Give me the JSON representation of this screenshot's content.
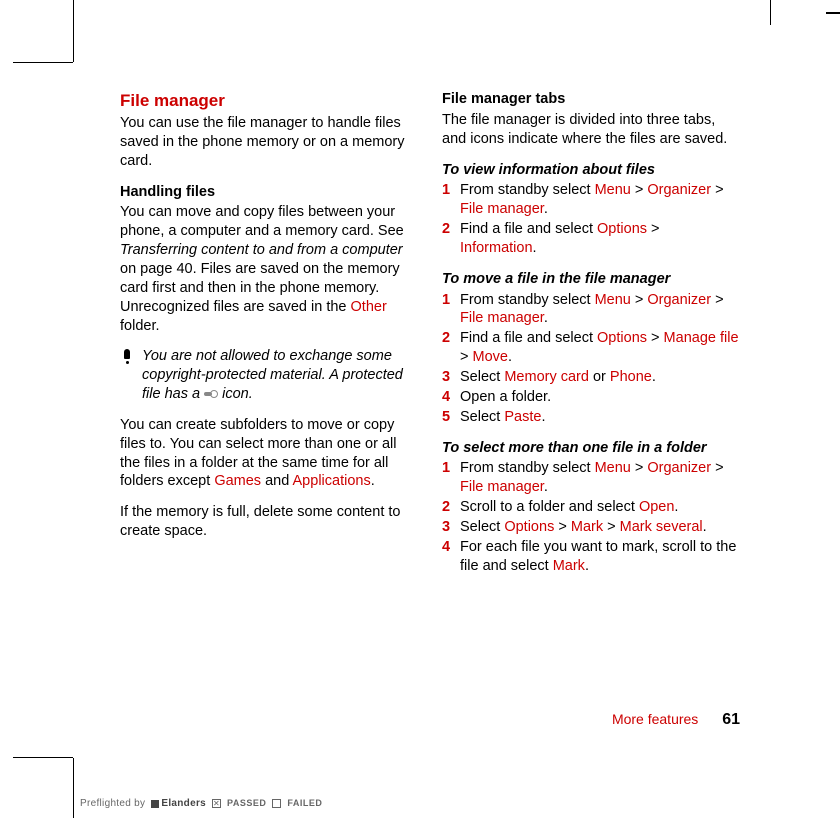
{
  "left": {
    "heading": "File manager",
    "intro": "You can use the file manager to handle files saved in the phone memory or on a memory card.",
    "handling_heading": "Handling files",
    "handling_body_a": "You can move and copy files between your phone, a computer and a memory card. See ",
    "handling_body_ref": "Transferring content to and from a computer",
    "handling_body_b": " on page 40. Files are saved on the memory card first and then in the phone memory. Unrecognized files are saved in the ",
    "handling_body_link": "Other",
    "handling_body_c": " folder.",
    "note_a": "You are not allowed to exchange some copyright-protected material. A protected file has a ",
    "note_b": " icon.",
    "subfolders_a": "You can create subfolders to move or copy files to. You can select more than one or all the files in a folder at the same time for all folders except ",
    "subfolders_link1": "Games",
    "subfolders_mid": " and ",
    "subfolders_link2": "Applications",
    "subfolders_c": ".",
    "memory_full": "If the memory is full, delete some content to create space."
  },
  "right": {
    "tabs_heading": "File manager tabs",
    "tabs_body": "The file manager is divided into three tabs, and icons indicate where the files are saved.",
    "view_heading": "To view information about files",
    "view_steps": [
      {
        "pre": "From standby select ",
        "l1": "Menu",
        "m1": " > ",
        "l2": "Organizer",
        "m2": " > ",
        "l3": "File manager",
        "post": "."
      },
      {
        "pre": "Find a file and select ",
        "l1": "Options",
        "m1": " > ",
        "l2": "Information",
        "post": "."
      }
    ],
    "move_heading": "To move a file in the file manager",
    "move_steps": [
      {
        "pre": "From standby select ",
        "l1": "Menu",
        "m1": " > ",
        "l2": "Organizer",
        "m2": " > ",
        "l3": "File manager",
        "post": "."
      },
      {
        "pre": "Find a file and select ",
        "l1": "Options",
        "m1": " > ",
        "l2": "Manage file",
        "m2": " > ",
        "l3": "Move",
        "post": "."
      },
      {
        "pre": "Select ",
        "l1": "Memory card",
        "m1": " or ",
        "l2": "Phone",
        "post": "."
      },
      {
        "pre": "Open a folder."
      },
      {
        "pre": "Select ",
        "l1": "Paste",
        "post": "."
      }
    ],
    "select_heading": "To select more than one file in a folder",
    "select_steps": [
      {
        "pre": "From standby select ",
        "l1": "Menu",
        "m1": " > ",
        "l2": "Organizer",
        "m2": " > ",
        "l3": "File manager",
        "post": "."
      },
      {
        "pre": "Scroll to a folder and select ",
        "l1": "Open",
        "post": "."
      },
      {
        "pre": "Select ",
        "l1": "Options",
        "m1": " > ",
        "l2": "Mark",
        "m2": " > ",
        "l3": "Mark several",
        "post": "."
      },
      {
        "pre": "For each file you want to mark, scroll to the file and select ",
        "l1": "Mark",
        "post": "."
      }
    ]
  },
  "footer": {
    "section": "More features",
    "page": "61"
  },
  "preflight": {
    "by": "Preflighted by",
    "company": "Elanders",
    "passed": "PASSED",
    "failed": "FAILED"
  }
}
